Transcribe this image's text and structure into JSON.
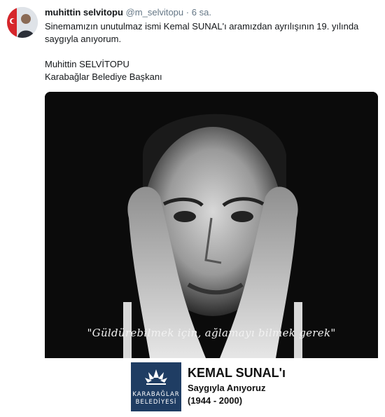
{
  "tweet": {
    "display_name": "muhittin selvitopu",
    "handle": "@m_selvitopu",
    "separator": "·",
    "time": "6 sa.",
    "text_line1": "Sinemamızın unutulmaz ismi Kemal SUNAL'ı aramızdan ayrılışının 19. yılında",
    "text_line2": "saygıyla anıyorum.",
    "signature_name": "Muhittin SELVİTOPU",
    "signature_title": "Karabağlar Belediye Başkanı"
  },
  "media": {
    "quote": "\"Güldürebilmek için, ağlamayı bilmek gerek\"",
    "logo_line1": "KARABAĞLAR",
    "logo_line2": "BELEDİYESİ",
    "card_title": "KEMAL SUNAL'ı",
    "card_subtitle": "Saygıyla Anıyoruz",
    "card_years": "(1944 - 2000)"
  }
}
